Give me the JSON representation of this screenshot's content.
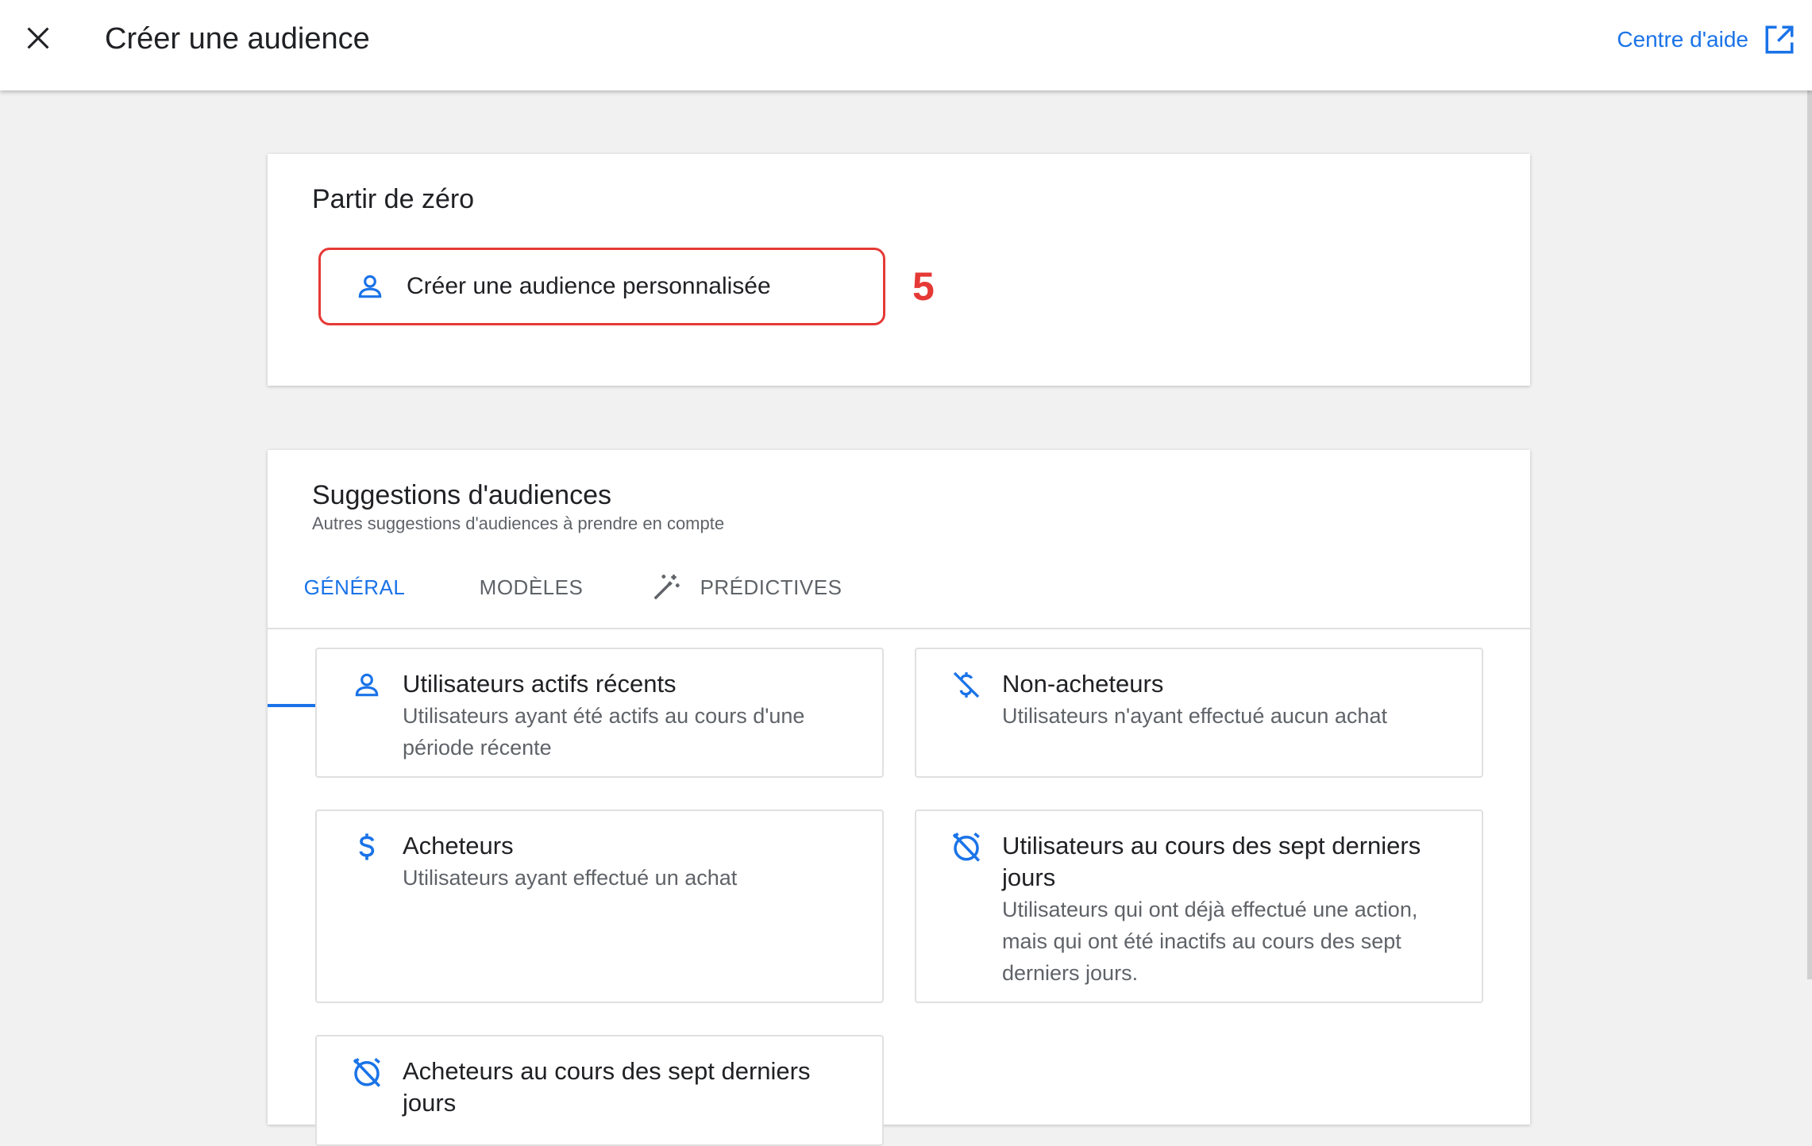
{
  "header": {
    "title": "Créer une audience",
    "help_label": "Centre d'aide"
  },
  "start_section": {
    "title": "Partir de zéro",
    "custom_button_label": "Créer une audience personnalisée",
    "step_number": "5"
  },
  "suggestions": {
    "title": "Suggestions d'audiences",
    "subtitle": "Autres suggestions d'audiences à prendre en compte",
    "tabs": [
      {
        "label": "GÉNÉRAL",
        "active": true
      },
      {
        "label": "MODÈLES",
        "active": false
      },
      {
        "label": "PRÉDICTIVES",
        "active": false,
        "icon": "magic-wand-icon"
      }
    ],
    "items": [
      {
        "title": "Utilisateurs actifs récents",
        "description": "Utilisateurs ayant été actifs au cours d'une période récente",
        "icon": "person-icon"
      },
      {
        "title": "Non-acheteurs",
        "description": "Utilisateurs n'ayant effectué aucun achat",
        "icon": "money-off-icon"
      },
      {
        "title": "Acheteurs",
        "description": "Utilisateurs ayant effectué un achat",
        "icon": "dollar-icon"
      },
      {
        "title": "Utilisateurs au cours des sept derniers jours",
        "description": "Utilisateurs qui ont déjà effectué une action, mais qui ont été inactifs au cours des sept derniers jours.",
        "icon": "alarm-off-icon"
      },
      {
        "title": "Acheteurs au cours des sept derniers jours",
        "description": "",
        "icon": "alarm-off-icon"
      }
    ]
  },
  "colors": {
    "accent": "#1a73e8",
    "highlight": "#e53935",
    "background": "#f1f1f1"
  }
}
